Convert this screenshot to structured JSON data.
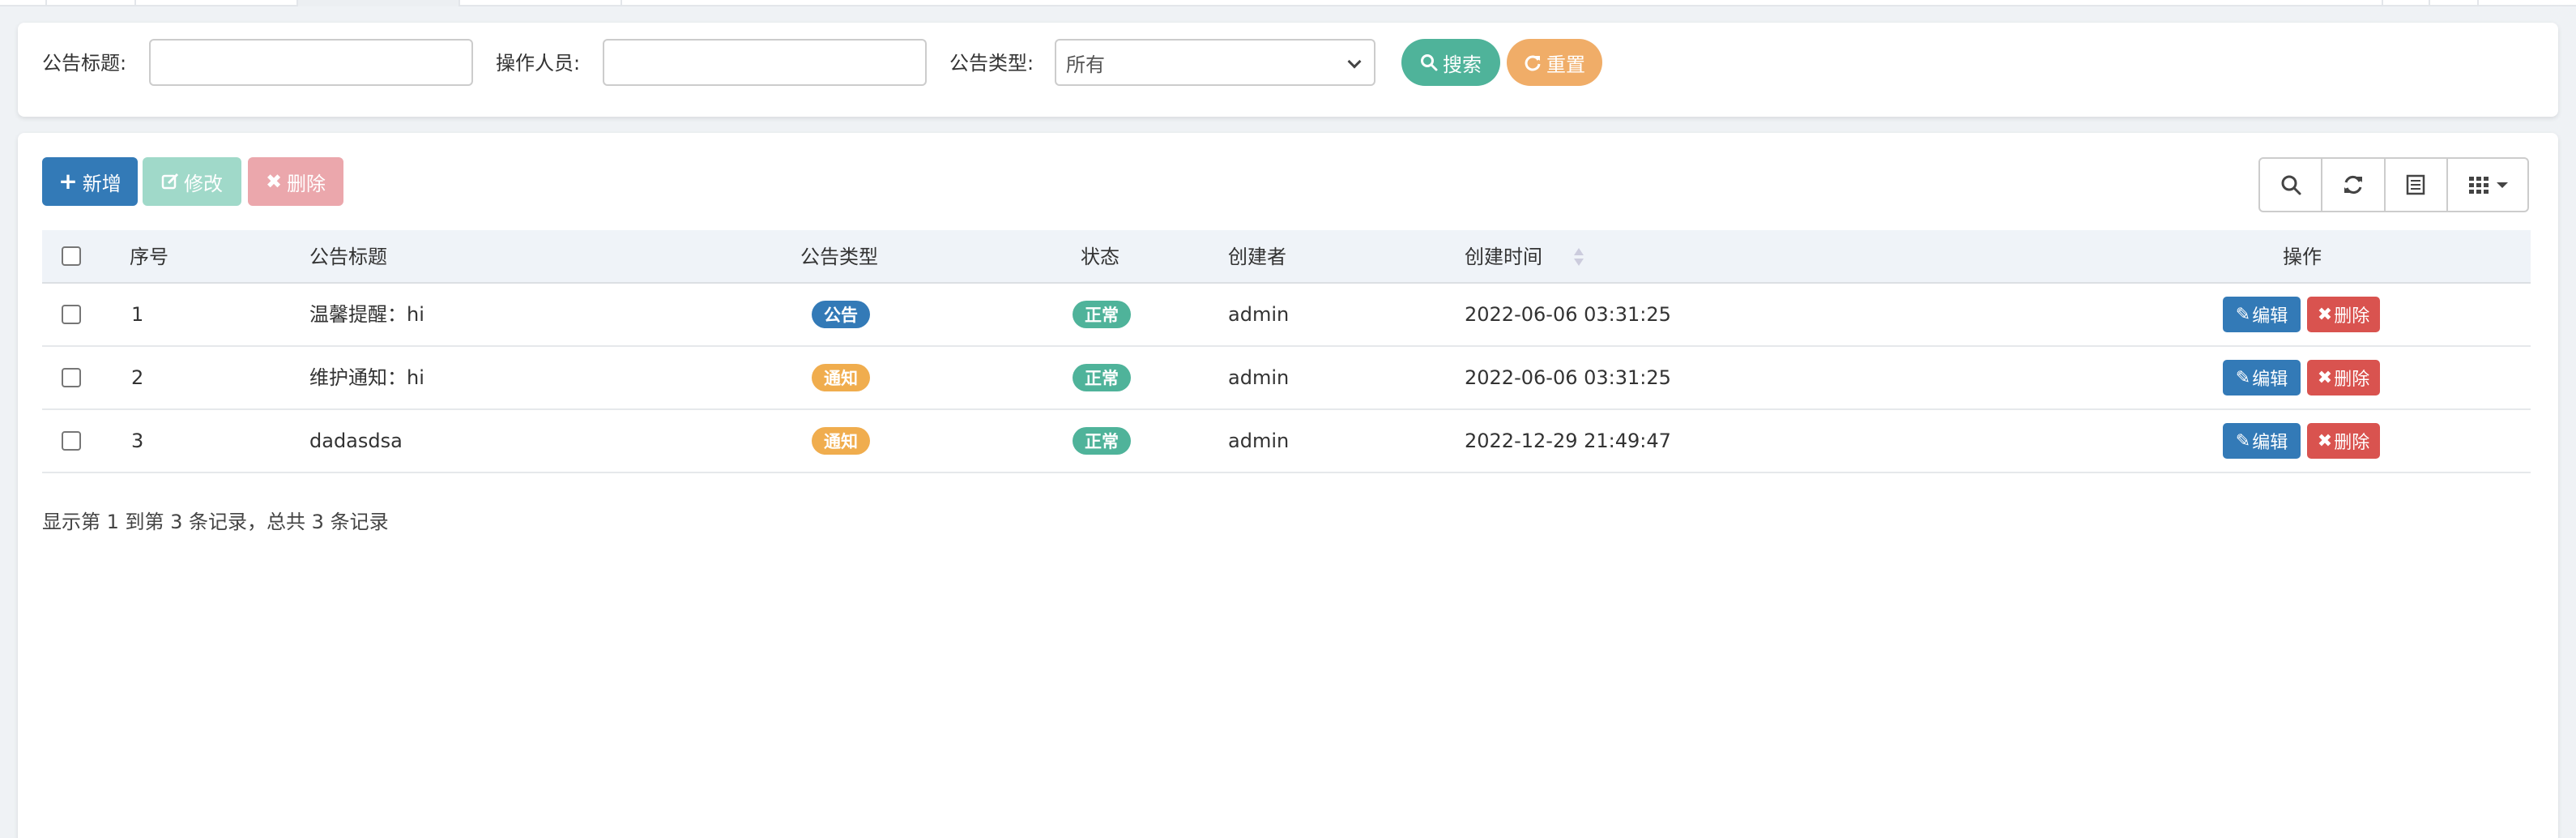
{
  "search": {
    "title_label": "公告标题:",
    "title_value": "",
    "operator_label": "操作人员:",
    "operator_value": "",
    "type_label": "公告类型:",
    "type_selected": "所有",
    "search_button": "搜索",
    "reset_button": "重置"
  },
  "toolbar": {
    "add": "新增",
    "edit": "修改",
    "delete": "删除"
  },
  "table": {
    "headers": {
      "index": "序号",
      "title": "公告标题",
      "type": "公告类型",
      "status": "状态",
      "creator": "创建者",
      "created_at": "创建时间",
      "actions": "操作"
    },
    "rows": [
      {
        "index": "1",
        "title": "温馨提醒：hi",
        "type": "公告",
        "status": "正常",
        "creator": "admin",
        "created_at": "2022-06-06 03:31:25",
        "edit": "编辑",
        "delete": "删除"
      },
      {
        "index": "2",
        "title": "维护通知：hi",
        "type": "通知",
        "status": "正常",
        "creator": "admin",
        "created_at": "2022-06-06 03:31:25",
        "edit": "编辑",
        "delete": "删除"
      },
      {
        "index": "3",
        "title": "dadasdsa",
        "type": "通知",
        "status": "正常",
        "creator": "admin",
        "created_at": "2022-12-29 21:49:47",
        "edit": "编辑",
        "delete": "删除"
      }
    ]
  },
  "pagination": {
    "summary": "显示第 1 到第 3 条记录，总共 3 条记录"
  },
  "colors": {
    "primary": "#337ab7",
    "success": "#4fb39a",
    "warning": "#f0ad4e",
    "danger": "#d9534f"
  },
  "icons": [
    "search-icon",
    "refresh-icon",
    "plus-icon",
    "edit-icon",
    "close-icon",
    "columns-icon",
    "export-icon",
    "sort-icon"
  ]
}
